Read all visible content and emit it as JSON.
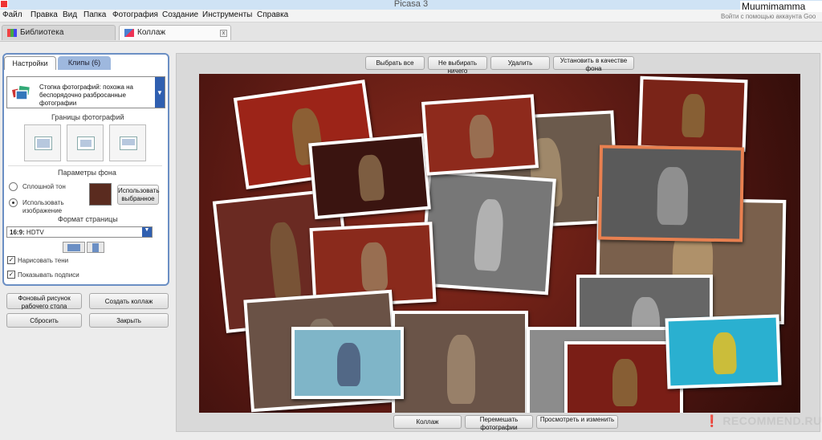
{
  "window": {
    "title": "Picasa 3",
    "user": "Muumimamma",
    "help_text": "Войти с помощью аккаунта Goo"
  },
  "menu": [
    "Файл",
    "Правка",
    "Вид",
    "Папка",
    "Фотография",
    "Создание",
    "Инструменты",
    "Справка"
  ],
  "tabs": {
    "library": "Библиотека",
    "collage": "Коллаж",
    "close": "x"
  },
  "panel": {
    "tab_settings": "Настройки",
    "tab_clips": "Клипы (6)",
    "layout_text": "Стопка фотографий: похожа на беспорядочно разбросанные фотографии",
    "dropdown_arrow": "▼",
    "borders_label": "Границы фотографий",
    "bg_label": "Параметры фона",
    "radio_solid": "Сплошной тон",
    "radio_image": "Использовать изображение",
    "use_selected": "Использовать выбранное",
    "page_format_label": "Формат страницы",
    "page_format_ratio": "16:9:",
    "page_format_value": "HDTV",
    "draw_shadows": "Нарисовать тени",
    "show_captions": "Показывать подписи",
    "check_mark": "✓"
  },
  "actions": {
    "desktop_bg": "Фоновый рисунок рабочего стола",
    "create_collage": "Создать коллаж",
    "reset": "Сбросить",
    "close": "Закрыть"
  },
  "toolbar": {
    "select_all": "Выбрать все",
    "select_none": "Не выбирать ничего",
    "delete": "Удалить",
    "set_bg": "Установить в качестве фона"
  },
  "bottom": {
    "collage": "Коллаж",
    "shuffle": "Перемешать фотографии",
    "preview": "Просмотреть и изменить"
  },
  "watermark": "❗ RECOMMEND.RU",
  "colors": {
    "accent": "#2f5fb0",
    "panel_border": "#6b8fc4",
    "carpet": "#6a1c14"
  }
}
